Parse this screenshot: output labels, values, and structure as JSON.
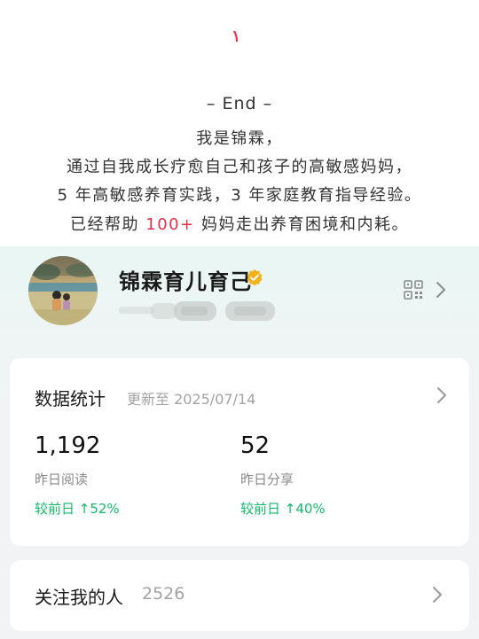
{
  "article_end": {
    "end_text": "– End –",
    "bio_line_1": "我是锦霖，",
    "bio_line_2": "通过自我成长疗愈自己和孩子的高敏感妈妈，",
    "bio_line_3": "5 年高敏感养育实践，3 年家庭教育指导经验。",
    "bio_line_4_prefix": "已经帮助 ",
    "bio_line_4_highlight": "100+",
    "bio_line_4_suffix": " 妈妈走出养育困境和内耗。",
    "highlight_color": "#e0314b"
  },
  "profile": {
    "name": "锦霖育儿育己",
    "verified_icon": "verified-badge-icon",
    "qr_icon": "qr-code-icon",
    "chevron_icon": "chevron-right-icon"
  },
  "stats": {
    "title": "数据统计",
    "updated": "更新至 2025/07/14",
    "metrics": [
      {
        "value": "1,192",
        "label": "昨日阅读",
        "change": "较前日 ↑52%"
      },
      {
        "value": "52",
        "label": "昨日分享",
        "change": "较前日 ↑40%"
      }
    ],
    "change_color": "#16b86b"
  },
  "followers": {
    "label": "关注我的人",
    "count": "2526"
  }
}
